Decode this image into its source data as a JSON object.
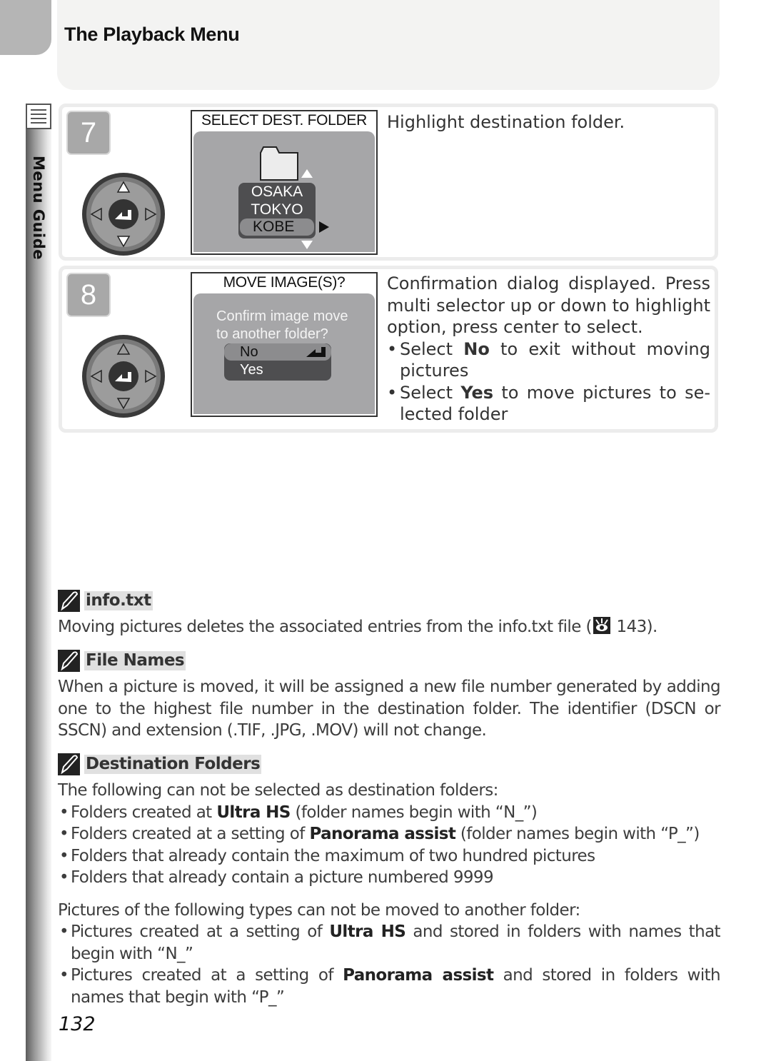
{
  "header": {
    "title": "The Playback Menu"
  },
  "sidebar": {
    "label": "Menu Guide",
    "icon": "menu-list-icon"
  },
  "steps": [
    {
      "number": "7",
      "screen": {
        "title": "SELECT DEST. FOLDER",
        "folders": [
          "OSAKA",
          "TOKYO",
          "KOBE"
        ],
        "selected": "KOBE"
      },
      "description": "Highlight destination folder."
    },
    {
      "number": "8",
      "screen": {
        "title": "MOVE IMAGE(S)?",
        "prompt_line1": "Confirm image move",
        "prompt_line2": "to another folder?",
        "options": [
          "No",
          "Yes"
        ],
        "selected": "No"
      },
      "description": "Confirmation dialog displayed.  Press multi selector up or down to highlight option, press center to select.",
      "bullets": [
        {
          "pre": "Select ",
          "bold": "No",
          "post": " to exit without moving pictures"
        },
        {
          "pre": "Select ",
          "bold": "Yes",
          "post": " to move pictures to se-lected folder"
        }
      ]
    }
  ],
  "notes": [
    {
      "title": "info.txt",
      "text_pre": "Moving pictures deletes the associated entries from the info.txt file (",
      "ref_icon": "see-reference-eye-icon",
      "ref_page": "143",
      "text_post": ")."
    },
    {
      "title": "File Names",
      "text": "When a picture is moved, it will be assigned a new file number generated by adding one to the highest file number in the destination folder.  The identifier (DSCN or SSCN) and extension (.TIF, .JPG, .MOV) will not change."
    },
    {
      "title": "Destination Folders",
      "intro": "The following can not be selected as destination folders:",
      "items": [
        {
          "pre": "Folders created at ",
          "bold": "Ultra HS",
          "post": " (folder names begin with “N_”)"
        },
        {
          "pre": "Folders created at a setting of ",
          "bold": "Panorama assist",
          "post": " (folder names begin with “P_”)"
        },
        {
          "pre": "Folders that already contain the maximum of two hundred pictures",
          "bold": "",
          "post": ""
        },
        {
          "pre": "Folders that already contain a picture numbered 9999",
          "bold": "",
          "post": ""
        }
      ],
      "intro2": "Pictures of the following types can not be moved to another folder:",
      "items2": [
        {
          "pre": "Pictures created at a setting of ",
          "bold": "Ultra HS",
          "post": " and stored in folders with names that begin with “N_”"
        },
        {
          "pre": "Pictures created at a setting of ",
          "bold": "Panorama assist",
          "post": " and stored in folders with names that begin with “P_”"
        }
      ]
    }
  ],
  "footer": {
    "page_number": "132"
  }
}
